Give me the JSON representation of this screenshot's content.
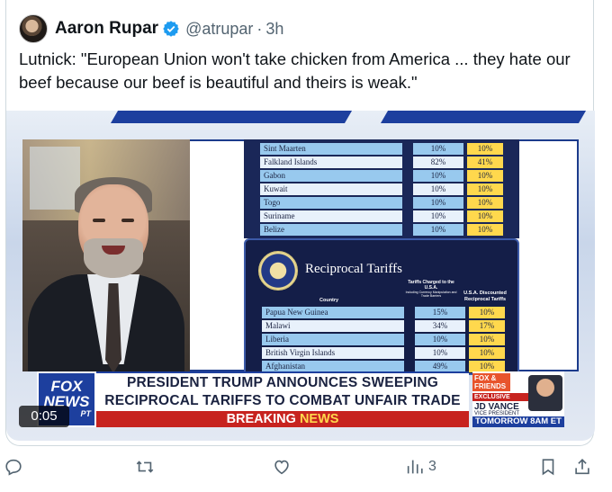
{
  "author": {
    "name": "Aaron Rupar",
    "handle": "@atrupar",
    "separator": "·",
    "time": "3h"
  },
  "tweet": {
    "text": "Lutnick: \"European Union won't take chicken from America ... they hate our beef because our beef is beautiful and theirs is weak.\""
  },
  "video": {
    "duration": "0:05",
    "tariff_table_top": [
      {
        "country": "Sint Maarten",
        "charged": "10%",
        "discounted": "10%"
      },
      {
        "country": "Falkland Islands",
        "charged": "82%",
        "discounted": "41%"
      },
      {
        "country": "Gabon",
        "charged": "10%",
        "discounted": "10%"
      },
      {
        "country": "Kuwait",
        "charged": "10%",
        "discounted": "10%"
      },
      {
        "country": "Togo",
        "charged": "10%",
        "discounted": "10%"
      },
      {
        "country": "Suriname",
        "charged": "10%",
        "discounted": "10%"
      },
      {
        "country": "Belize",
        "charged": "10%",
        "discounted": "10%"
      }
    ],
    "board": {
      "title": "Reciprocal Tariffs",
      "header_country": "Country",
      "header_charged": "Tariffs Charged to the U.S.A.",
      "header_charged_sub": "Including Currency Manipulation and Trade Barriers",
      "header_discounted": "U.S.A. Discounted Reciprocal Tariffs"
    },
    "tariff_table_bottom": [
      {
        "country": "Papua New Guinea",
        "charged": "15%",
        "discounted": "10%"
      },
      {
        "country": "Malawi",
        "charged": "34%",
        "discounted": "17%"
      },
      {
        "country": "Liberia",
        "charged": "10%",
        "discounted": "10%"
      },
      {
        "country": "British Virgin Islands",
        "charged": "10%",
        "discounted": "10%"
      },
      {
        "country": "Afghanistan",
        "charged": "49%",
        "discounted": "10%"
      }
    ],
    "chyron": {
      "network_logo": "FOX NEWS",
      "network_logo_sub": "PT",
      "headline_line1": "PRESIDENT TRUMP ANNOUNCES SWEEPING",
      "headline_line2": "RECIPROCAL TARIFFS TO COMBAT UNFAIR TRADE PRACTICES",
      "breaking_word1": "BREAKING",
      "breaking_word2": "NEWS"
    },
    "promo": {
      "show": "FOX & FRIENDS",
      "tag": "EXCLUSIVE",
      "guest": "JD VANCE",
      "guest_title": "VICE PRESIDENT",
      "when": "TOMORROW 8AM ET"
    }
  },
  "actions": {
    "reply_count": "",
    "retweet_count": "",
    "like_count": "",
    "views_count": "3"
  },
  "colors": {
    "verified_blue": "#1d9bf0",
    "text_primary": "#0f1419",
    "text_secondary": "#536471",
    "fox_blue": "#1d3f9e",
    "breaking_red": "#c7231f",
    "tariff_yellow": "#ffd84d"
  }
}
